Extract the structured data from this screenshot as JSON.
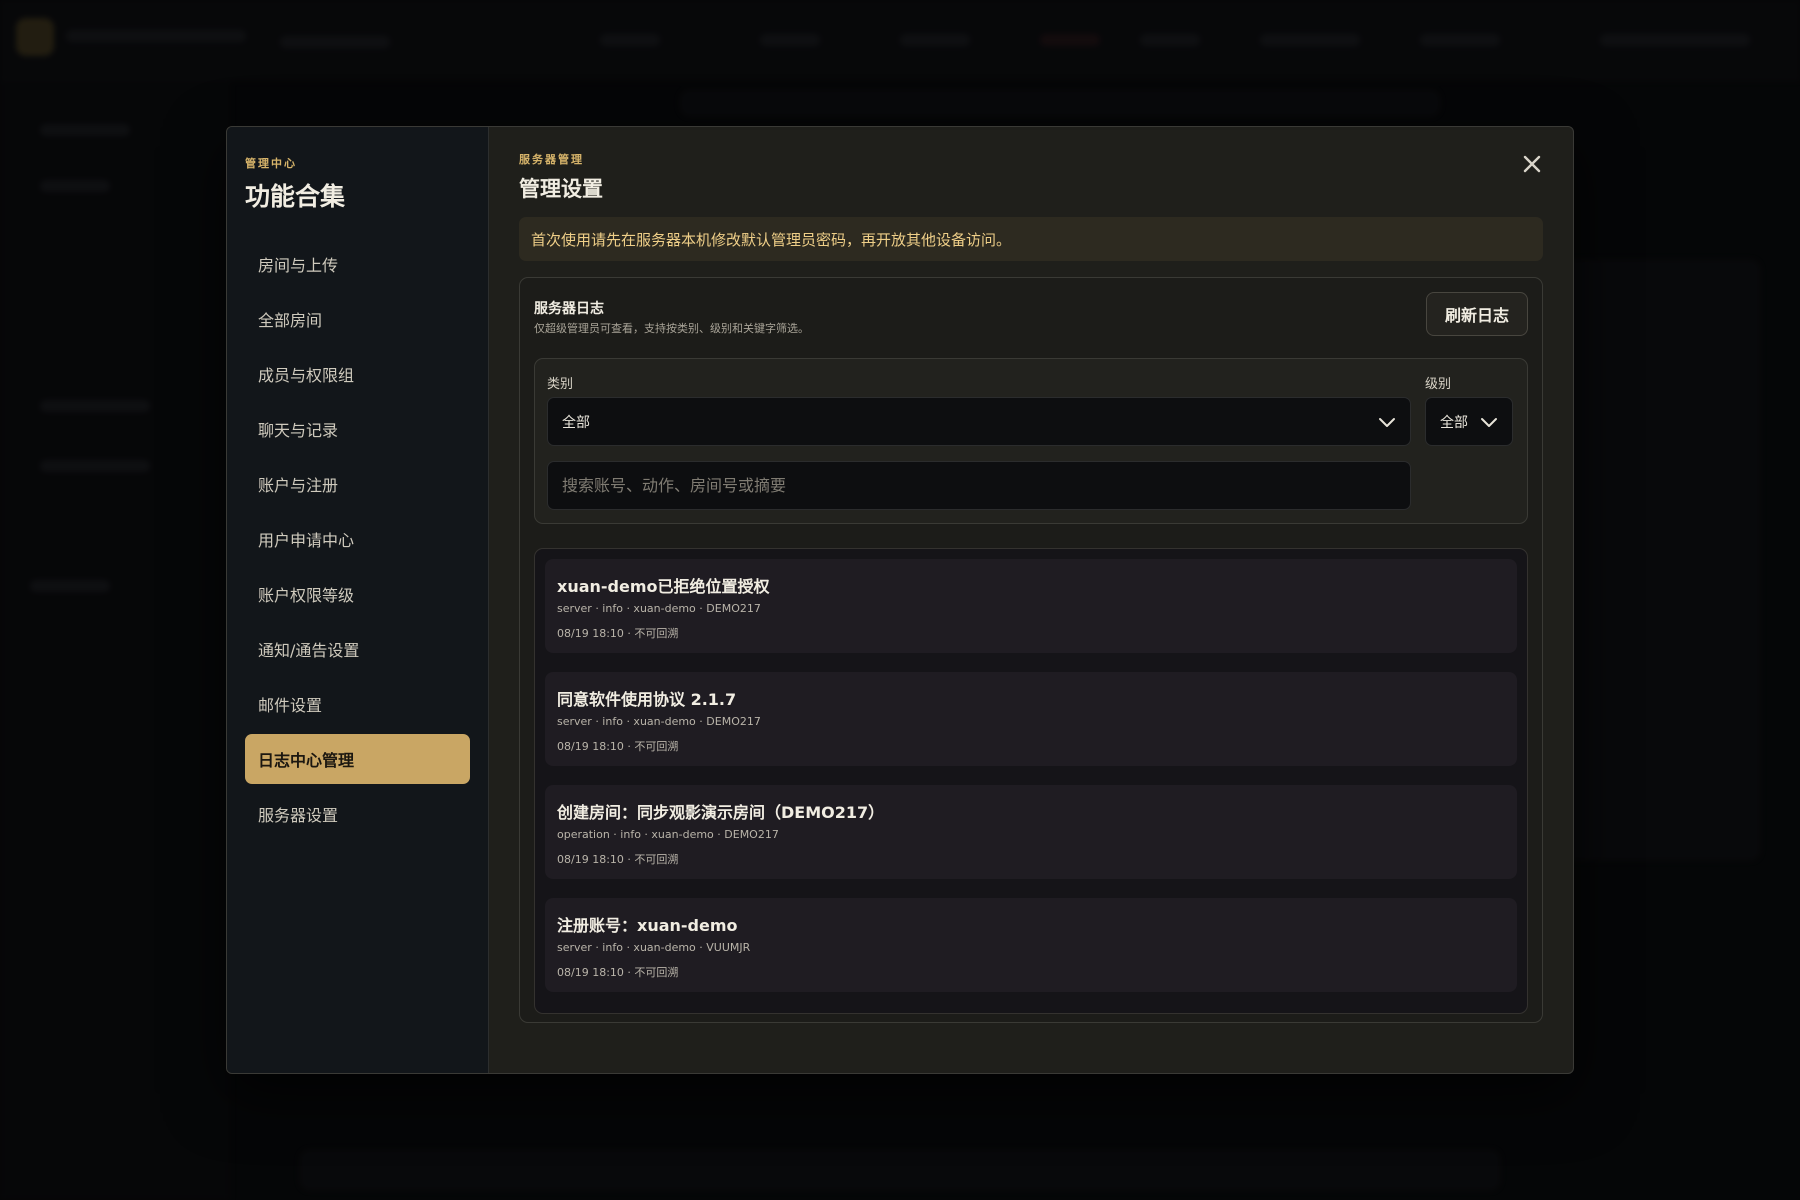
{
  "sidebar": {
    "eyebrow": "管理中心",
    "title": "功能合集",
    "items": [
      {
        "label": "房间与上传"
      },
      {
        "label": "全部房间"
      },
      {
        "label": "成员与权限组"
      },
      {
        "label": "聊天与记录"
      },
      {
        "label": "账户与注册"
      },
      {
        "label": "用户申请中心"
      },
      {
        "label": "账户权限等级"
      },
      {
        "label": "通知/通告设置"
      },
      {
        "label": "邮件设置"
      },
      {
        "label": "日志中心管理",
        "active": true
      },
      {
        "label": "服务器设置"
      }
    ]
  },
  "main": {
    "eyebrow": "服务器管理",
    "title": "管理设置",
    "notice": "首次使用请先在服务器本机修改默认管理员密码，再开放其他设备访问。"
  },
  "log_section": {
    "title": "服务器日志",
    "subtitle": "仅超级管理员可查看，支持按类别、级别和关键字筛选。",
    "refresh_label": "刷新日志",
    "category_label": "类别",
    "category_value": "全部",
    "level_label": "级别",
    "level_value": "全部",
    "search_placeholder": "搜索账号、动作、房间号或摘要",
    "entries": [
      {
        "title": "xuan-demo已拒绝位置授权",
        "meta": "server · info · xuan-demo · DEMO217",
        "time": "08/19 18:10 · 不可回溯"
      },
      {
        "title": "同意软件使用协议 2.1.7",
        "meta": "server · info · xuan-demo · DEMO217",
        "time": "08/19 18:10 · 不可回溯"
      },
      {
        "title": "创建房间：同步观影演示房间（DEMO217）",
        "meta": "operation · info · xuan-demo · DEMO217",
        "time": "08/19 18:10 · 不可回溯"
      },
      {
        "title": "注册账号：xuan-demo",
        "meta": "server · info · xuan-demo · VUUMJR",
        "time": "08/19 18:10 · 不可回溯"
      }
    ]
  },
  "icons": {
    "close": "close-icon",
    "chevron": "chevron-down-icon"
  },
  "colors": {
    "accent": "#c9a664",
    "notice_text": "#efcf88",
    "modal_bg": "#1f1f1b",
    "sidebar_bg": "#12161a"
  }
}
